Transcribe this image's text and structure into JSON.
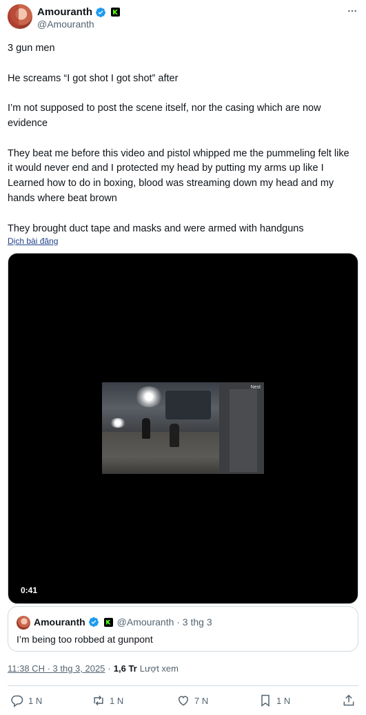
{
  "author": {
    "display_name": "Amouranth",
    "handle": "@Amouranth"
  },
  "tweet": {
    "paragraphs": [
      "3 gun men",
      "He screams “I got shot I got shot” after",
      "I’m not supposed to post the scene itself,  nor the casing which are now evidence",
      "They beat me before this video and pistol whipped me  the pummeling felt like it would never end and I protected  my head by putting my arms up like I Learned how to do in boxing, blood was streaming down my head and my hands where beat brown",
      "They brought duct tape and masks and were armed with handguns"
    ],
    "translate_label": "Dịch bài đăng"
  },
  "video": {
    "watermark": "Nest",
    "duration": "0:41"
  },
  "quote": {
    "display_name": "Amouranth",
    "handle_date": "@Amouranth · 3 thg 3",
    "text": "I’m being too robbed at gunpont"
  },
  "meta": {
    "timestamp": "11:38 CH · 3 thg 3, 2025",
    "separator": "·",
    "views_count": "1,6 Tr",
    "views_label": "Lượt xem"
  },
  "actions": {
    "replies": "1 N",
    "reposts": "1 N",
    "likes": "7 N",
    "bookmarks": "1 N"
  },
  "colors": {
    "text_primary": "#0f1419",
    "text_secondary": "#536471",
    "verified_blue": "#1d9bf0",
    "border": "#cfd9de",
    "kick_green": "#53fc18"
  }
}
